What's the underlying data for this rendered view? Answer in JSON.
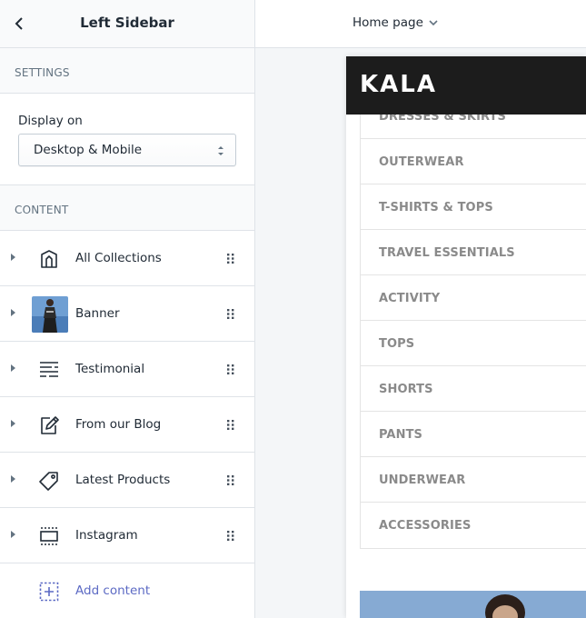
{
  "sidebar": {
    "title": "Left Sidebar",
    "settings_label": "SETTINGS",
    "display_on_label": "Display on",
    "display_on_value": "Desktop & Mobile",
    "content_label": "CONTENT",
    "items": [
      {
        "label": "All Collections",
        "icon": "collections-icon"
      },
      {
        "label": "Banner",
        "icon": "banner-thumbnail"
      },
      {
        "label": "Testimonial",
        "icon": "text-lines-icon"
      },
      {
        "label": "From our Blog",
        "icon": "blog-edit-icon"
      },
      {
        "label": "Latest Products",
        "icon": "tag-icon"
      },
      {
        "label": "Instagram",
        "icon": "instagram-frame-icon"
      }
    ],
    "add_content_label": "Add content"
  },
  "topbar": {
    "page_select": "Home page"
  },
  "preview": {
    "logo": "KALA",
    "categories": [
      "DRESSES & SKIRTS",
      "OUTERWEAR",
      "T-SHIRTS & TOPS",
      "TRAVEL ESSENTIALS",
      "ACTIVITY",
      "TOPS",
      "SHORTS",
      "PANTS",
      "UNDERWEAR",
      "ACCESSORIES"
    ]
  },
  "colors": {
    "accent": "#5c6ac4",
    "store_header": "#1c1c1c",
    "category_text": "#8a8a8a"
  }
}
